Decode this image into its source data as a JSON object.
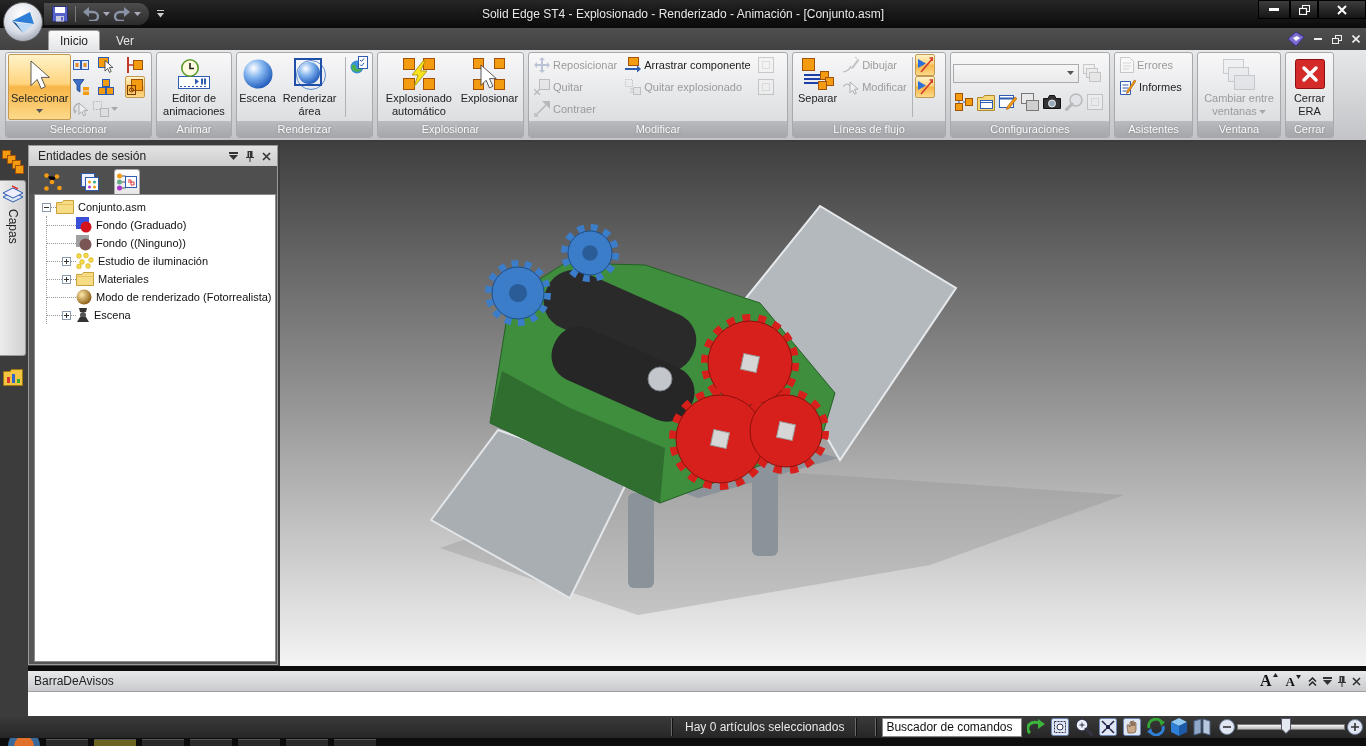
{
  "window": {
    "title": "Solid Edge ST4 - Explosionado - Renderizado - Animación - [Conjunto.asm]"
  },
  "ribbon_tabs": [
    {
      "label": "Inicio",
      "selected": true
    },
    {
      "label": "Ver",
      "selected": false
    }
  ],
  "ribbon_groups": [
    {
      "label": "Seleccionar",
      "items": [
        {
          "kind": "split",
          "label": "Seleccionar",
          "on": true,
          "disabled": false
        },
        {
          "kind": "stack",
          "items": [
            {
              "kind": "icon",
              "on": false,
              "disabled": false
            },
            {
              "kind": "icon",
              "on": false,
              "disabled": false
            },
            {
              "kind": "icon",
              "on": false,
              "disabled": true
            }
          ]
        },
        {
          "kind": "stack",
          "items": [
            {
              "kind": "icon",
              "on": false,
              "disabled": false
            },
            {
              "kind": "icon",
              "on": false,
              "disabled": false
            },
            {
              "kind": "icon",
              "on": false,
              "disabled": true,
              "dropdown": true
            }
          ]
        },
        {
          "kind": "stack",
          "items": [
            {
              "kind": "icon",
              "on": false,
              "disabled": false
            },
            {
              "kind": "icon",
              "on": true,
              "disabled": false
            }
          ]
        }
      ]
    },
    {
      "label": "Animar",
      "items": [
        {
          "kind": "large",
          "label": "Editor de animaciones",
          "on": false,
          "disabled": false
        }
      ]
    },
    {
      "label": "Renderizar",
      "items": [
        {
          "kind": "large",
          "label": "Escena",
          "on": false,
          "disabled": false
        },
        {
          "kind": "large",
          "label": "Renderizar área",
          "on": false,
          "disabled": false
        },
        {
          "kind": "separator"
        },
        {
          "kind": "stack",
          "items": [
            {
              "kind": "icon",
              "on": false,
              "disabled": false
            }
          ]
        }
      ]
    },
    {
      "label": "Explosionar",
      "items": [
        {
          "kind": "large",
          "label": "Explosionado automático",
          "on": false,
          "disabled": false
        },
        {
          "kind": "large",
          "label": "Explosionar",
          "on": false,
          "disabled": false
        }
      ]
    },
    {
      "label": "Modificar",
      "items": [
        {
          "kind": "stack",
          "items": [
            {
              "kind": "small",
              "label": "Reposicionar",
              "on": false,
              "disabled": true
            },
            {
              "kind": "small",
              "label": "Quitar",
              "on": false,
              "disabled": true
            },
            {
              "kind": "small",
              "label": "Contraer",
              "on": false,
              "disabled": true
            }
          ]
        },
        {
          "kind": "stack",
          "items": [
            {
              "kind": "small",
              "label": "Arrastrar componente",
              "on": false,
              "disabled": false
            },
            {
              "kind": "small",
              "label": "Quitar explosionado",
              "on": false,
              "disabled": true
            }
          ]
        },
        {
          "kind": "stack",
          "items": [
            {
              "kind": "icon",
              "on": false,
              "disabled": true
            },
            {
              "kind": "icon",
              "on": false,
              "disabled": true
            }
          ]
        }
      ]
    },
    {
      "label": "Líneas de flujo",
      "items": [
        {
          "kind": "large",
          "label": "Separar",
          "on": false,
          "disabled": false
        },
        {
          "kind": "stack",
          "items": [
            {
              "kind": "small",
              "label": "Dibujar",
              "on": false,
              "disabled": true
            },
            {
              "kind": "small",
              "label": "Modificar",
              "on": false,
              "disabled": true
            }
          ]
        },
        {
          "kind": "separator"
        },
        {
          "kind": "stack",
          "items": [
            {
              "kind": "icon",
              "on": true,
              "disabled": false
            },
            {
              "kind": "icon",
              "on": true,
              "disabled": false
            }
          ]
        }
      ]
    },
    {
      "label": "Configuraciones",
      "items": [
        {
          "kind": "stack",
          "items": [
            {
              "kind": "row",
              "items": [
                {
                  "kind": "combo"
                },
                {
                  "kind": "icon",
                  "on": false,
                  "disabled": true
                }
              ]
            },
            {
              "kind": "row",
              "items": [
                {
                  "kind": "icon",
                  "on": false,
                  "disabled": false
                },
                {
                  "kind": "icon",
                  "on": false,
                  "disabled": false
                },
                {
                  "kind": "icon",
                  "on": false,
                  "disabled": false
                },
                {
                  "kind": "icon",
                  "on": false,
                  "disabled": false
                },
                {
                  "kind": "icon",
                  "on": false,
                  "disabled": false
                },
                {
                  "kind": "icon",
                  "on": false,
                  "disabled": true
                },
                {
                  "kind": "icon",
                  "on": false,
                  "disabled": true
                }
              ]
            }
          ]
        }
      ]
    },
    {
      "label": "Asistentes",
      "items": [
        {
          "kind": "stack",
          "items": [
            {
              "kind": "small",
              "label": "Errores",
              "on": false,
              "disabled": true
            },
            {
              "kind": "small",
              "label": "Informes",
              "on": false,
              "disabled": false
            }
          ]
        }
      ]
    },
    {
      "label": "Ventana",
      "items": [
        {
          "kind": "large",
          "label": "Cambiar entre ventanas",
          "on": false,
          "disabled": true,
          "dropdown": true
        }
      ]
    },
    {
      "label": "Cerrar",
      "items": [
        {
          "kind": "large",
          "label": "Cerrar ERA",
          "on": false,
          "disabled": false
        }
      ]
    }
  ],
  "side_tab": {
    "label": "Capas"
  },
  "session_panel": {
    "title": "Entidades de sesión",
    "tabs": [
      {
        "selected": false
      },
      {
        "selected": false
      },
      {
        "selected": true
      }
    ],
    "tree": [
      {
        "kind": "branch",
        "label": "Conjunto.asm",
        "expanded": true,
        "children": [
          {
            "kind": "leaf",
            "label": "Fondo (Graduado)"
          },
          {
            "kind": "leaf",
            "label": "Fondo ((Ninguno))"
          },
          {
            "kind": "branch",
            "label": "Estudio de iluminación",
            "expanded": false
          },
          {
            "kind": "branch",
            "label": "Materiales",
            "expanded": false
          },
          {
            "kind": "leaf",
            "label": "Modo de renderizado (Fotorrealista)"
          },
          {
            "kind": "branch",
            "label": "Escena",
            "expanded": false
          }
        ]
      }
    ]
  },
  "message_bar": {
    "title": "BarraDeAvisos",
    "font_buttons": [
      "A",
      "A"
    ]
  },
  "status_bar": {
    "selection": "Hay 0 artículos seleccionados",
    "command_finder": {
      "placeholder": "Buscador de comandos"
    },
    "zoom": {
      "level": 0.45
    }
  }
}
